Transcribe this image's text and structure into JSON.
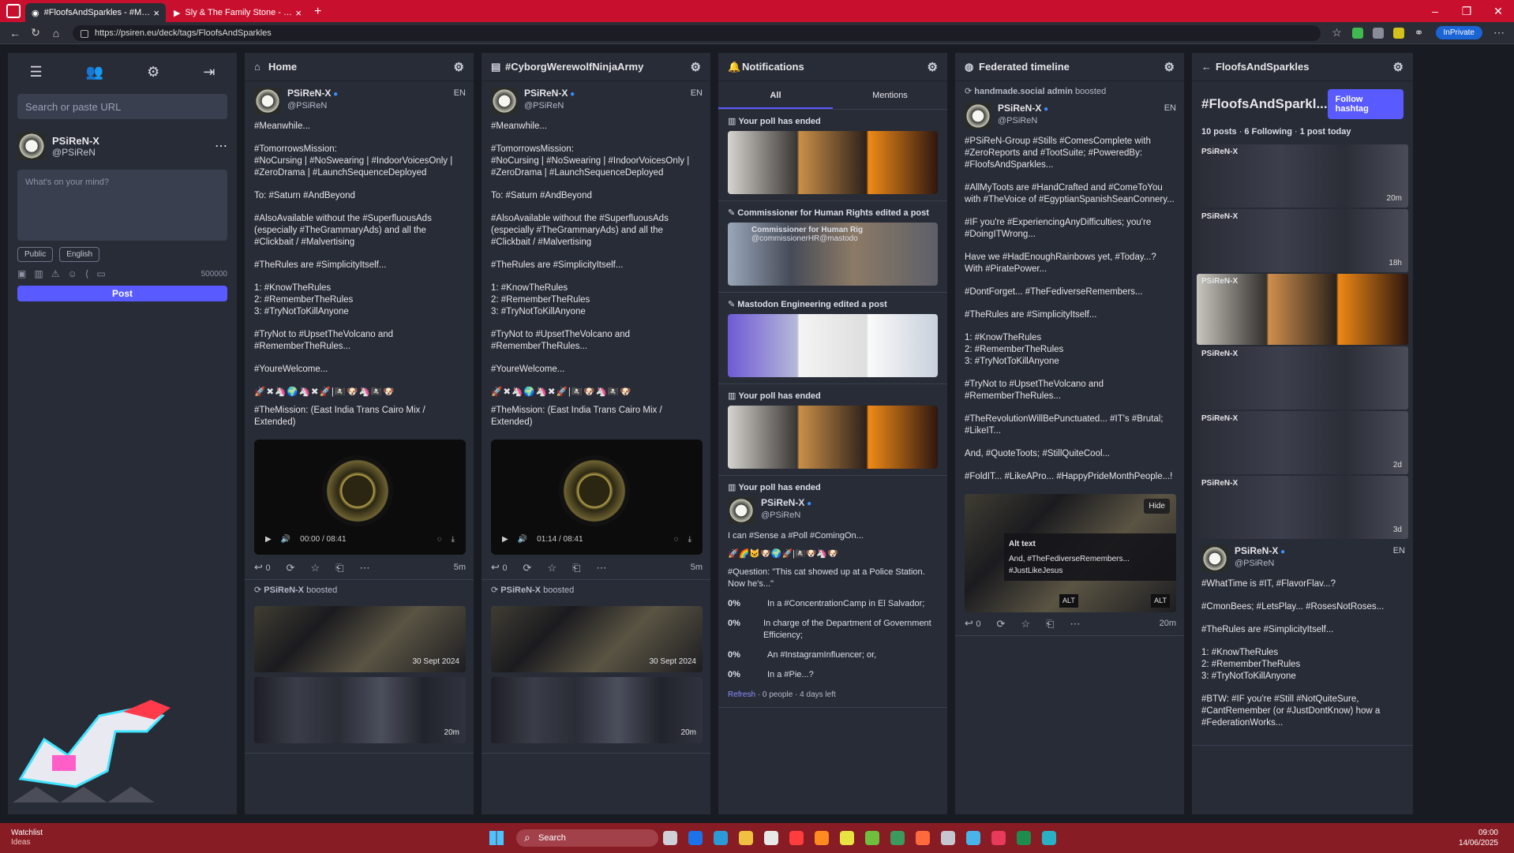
{
  "browser": {
    "tabs": [
      {
        "label": "#FloofsAndSparkles - #Mastodon"
      },
      {
        "label": "Sly & The Family Stone - Dance T..."
      }
    ],
    "url": "https://psiren.eu/deck/tags/FloofsAndSparkles",
    "inprivate": "InPrivate"
  },
  "sidebar": {
    "search_placeholder": "Search or paste URL",
    "user": {
      "name": "PSiReN-X",
      "handle": "@PSiReN"
    },
    "compose_placeholder": "What's on your mind?",
    "visibility": "Public",
    "language": "English",
    "char_count": "500000",
    "post_label": "Post"
  },
  "columns": {
    "home": {
      "title": "Home"
    },
    "ninja": {
      "title": "#CyborgWerewolfNinjaArmy"
    },
    "notifications": {
      "title": "Notifications",
      "tab_all": "All",
      "tab_mentions": "Mentions"
    },
    "federated": {
      "title": "Federated timeline"
    },
    "hashtag": {
      "title": "FloofsAndSparkles",
      "tag": "#FloofsAndSparkl...",
      "follow": "Follow hashtag",
      "posts": "10 posts",
      "following": "6 Following",
      "today": "1 post today"
    }
  },
  "post_main": {
    "name": "PSiReN-X",
    "handle": "@PSiReN",
    "lang": "EN",
    "l1": "#Meanwhile...",
    "l2": "#TomorrowsMission:\n#NoCursing | #NoSwearing | #IndoorVoicesOnly | #ZeroDrama | #LaunchSequenceDeployed",
    "l3": "To: #Saturn #AndBeyond",
    "l4": "#AlsoAvailable without the #SuperfluousAds (especially #TheGrammaryAds) and all the #Clickbait / #Malvertising",
    "l5": "#TheRules are #SimplicityItself...",
    "l6": "1: #KnowTheRules\n2: #RememberTheRules\n3: #TryNotToKillAnyone",
    "l7": "#TryNot to #UpsetTheVolcano and #RememberTheRules...",
    "l8": "#YoureWelcome...",
    "l9": "#TheMission: (East India Trans Cairo Mix / Extended)",
    "time_a": "00:00 / 08:41",
    "time_b": "01:14 / 08:41",
    "age": "5m",
    "replies": "0"
  },
  "boosts": {
    "boosted": "boosted",
    "by": "PSiReN-X",
    "date": "30 Sept 2024",
    "age": "20m"
  },
  "notifications": {
    "poll_ended": "Your poll has ended",
    "commish": "Commissioner for Human Rights edited a post",
    "commish_name": "Commissioner for Human Rig",
    "commish_handle": "@commissionerHR@mastodo",
    "engineering": "Mastodon Engineering edited a post",
    "poll_post": {
      "name": "PSiReN-X",
      "handle": "@PSiReN",
      "text": "I can #Sense a #Poll #ComingOn...",
      "question": "#Question: \"This cat showed up at a Police Station. Now he's...\"",
      "options": [
        {
          "pct": "0%",
          "label": "In a #ConcentrationCamp in El Salvador;"
        },
        {
          "pct": "0%",
          "label": "In charge of the Department of Government Efficiency;"
        },
        {
          "pct": "0%",
          "label": "An #InstagramInfluencer; or,"
        },
        {
          "pct": "0%",
          "label": "In a #Pie...?"
        }
      ],
      "refresh": "Refresh",
      "foot": "· 0 people · 4 days left"
    }
  },
  "federated": {
    "boost_by": "handmade.social admin",
    "boosted": "boosted",
    "name": "PSiReN-X",
    "handle": "@PSiReN",
    "l1": "#PSiReN-Group #Stills #ComesComplete with #ZeroReports and #TootSuite; #PoweredBy: #FloofsAndSparkles...",
    "l2": "#AllMyToots are #HandCrafted and #ComeToYou with #TheVoice of #EgyptianSpanishSeanConnery...",
    "l3": "#IF you're #ExperiencingAnyDifficulties; you're #DoingITWrong...",
    "l4": "Have we #HadEnoughRainbows yet, #Today...? With #PiratePower...",
    "l5": "#DontForget... #TheFediverseRemembers...",
    "l6": "#TheRules are #SimplicityItself...",
    "l7": "1: #KnowTheRules\n2: #RememberTheRules\n3: #TryNotToKillAnyone",
    "l8": "#TryNot to #UpsetTheVolcano and #RememberTheRules...",
    "l9": "#TheRevolutionWillBePunctuated... #IT's #Brutal; #LikeIT...",
    "l10": "And, #QuoteToots; #StillQuiteCool...",
    "l11": "#FoldIT... #LikeAPro... #HappyPrideMonthPeople...!",
    "hide": "Hide",
    "alt_title": "Alt text",
    "alt_text": "And, #TheFediverseRemembers... #JustLikeJesus",
    "alt": "ALT",
    "age": "20m"
  },
  "hashtag_feed": {
    "ages": [
      "20m",
      "18h",
      "2d",
      "3d"
    ],
    "last": {
      "name": "PSiReN-X",
      "handle": "@PSiReN",
      "l1": "#WhatTime is #IT, #FlavorFlav...?",
      "l2": "#CmonBees; #LetsPlay... #RosesNotRoses...",
      "l3": "#TheRules are #SimplicityItself...",
      "l4": "1: #KnowTheRules\n2: #RememberTheRules\n3: #TryNotToKillAnyone",
      "l5": "#BTW: #IF you're #Still #NotQuiteSure, #CantRemember (or #JustDontKnow) how a #FederationWorks..."
    }
  },
  "taskbar": {
    "watch": "Watchlist",
    "watch_sub": "Ideas",
    "search": "Search",
    "time": "09:00",
    "date": "14/06/2025"
  },
  "colors": {
    "accent": "#595aff",
    "titlebar": "#c8102e",
    "taskbar": "#881c24"
  }
}
